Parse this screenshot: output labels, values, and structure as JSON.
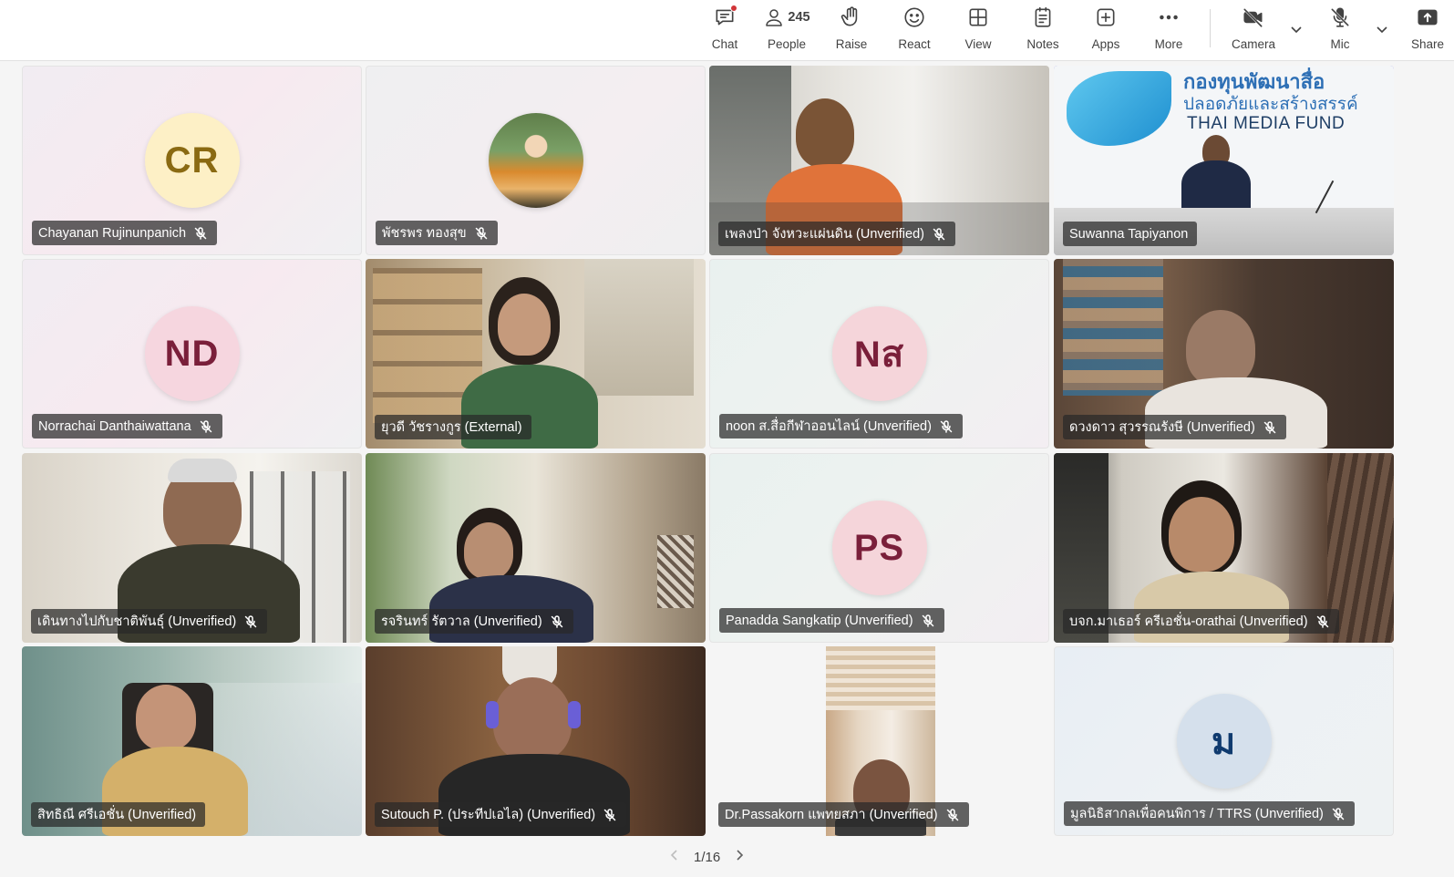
{
  "toolbar": {
    "chat_label": "Chat",
    "people_label": "People",
    "people_count": "245",
    "raise_label": "Raise",
    "react_label": "React",
    "view_label": "View",
    "notes_label": "Notes",
    "apps_label": "Apps",
    "more_label": "More",
    "camera_label": "Camera",
    "mic_label": "Mic",
    "share_label": "Share"
  },
  "tiles": [
    {
      "name": "Chayanan Rujinunpanich",
      "initials": "CR",
      "type": "avatar"
    },
    {
      "name": "พัชรพร ทองสุข",
      "type": "photo-avatar"
    },
    {
      "name": "เพลงป่า จังหวะแผ่นดิน (Unverified)",
      "type": "video"
    },
    {
      "name": "Suwanna Tapiyanon",
      "type": "video",
      "banner_line1": "กองทุนพัฒนาสื่อ",
      "banner_line2": "ปลอดภัยและสร้างสรรค์",
      "banner_line3": "THAI MEDIA FUND"
    },
    {
      "name": "Norrachai Danthaiwattana",
      "initials": "ND",
      "type": "avatar"
    },
    {
      "name": "ยุวดี วัชรางกูร (External)",
      "type": "video"
    },
    {
      "name": "noon ส.สื่อกีฬาออนไลน์ (Unverified)",
      "initials": "Nส",
      "type": "avatar"
    },
    {
      "name": "ดวงดาว สุวรรณรังษี (Unverified)",
      "type": "video"
    },
    {
      "name": "เดินทางไปกับชาติพันธุ์ (Unverified)",
      "type": "video"
    },
    {
      "name": "รจรินทร์ รัตวาล (Unverified)",
      "type": "video"
    },
    {
      "name": "Panadda Sangkatip (Unverified)",
      "initials": "PS",
      "type": "avatar"
    },
    {
      "name": "บจก.มาเธอร์ ครีเอชั่น-orathai (Unverified)",
      "type": "video"
    },
    {
      "name": "สิทธิณี ศรีเอชั่น (Unverified)",
      "type": "video"
    },
    {
      "name": "Sutouch P. (ประทีปเอไล) (Unverified)",
      "type": "video"
    },
    {
      "name": "Dr.Passakorn แพทยสภา (Unverified)",
      "type": "video"
    },
    {
      "name": "มูลนิธิสากลเพื่อคนพิการ / TTRS (Unverified)",
      "initials": "ม",
      "type": "avatar"
    }
  ],
  "pager": {
    "label": "1/16"
  },
  "colors": {
    "accent": "#6264d7",
    "avatar_cr_bg": "#fdf0c6",
    "avatar_cr_fg": "#8a6a12",
    "avatar_nd_bg": "#f6d6df",
    "avatar_nd_fg": "#7a1f3a",
    "avatar_ns_bg": "#f5d5da",
    "avatar_ps_bg": "#f5d5da",
    "avatar_m_bg": "#d5e0ec",
    "avatar_m_fg": "#0f3a6e"
  }
}
